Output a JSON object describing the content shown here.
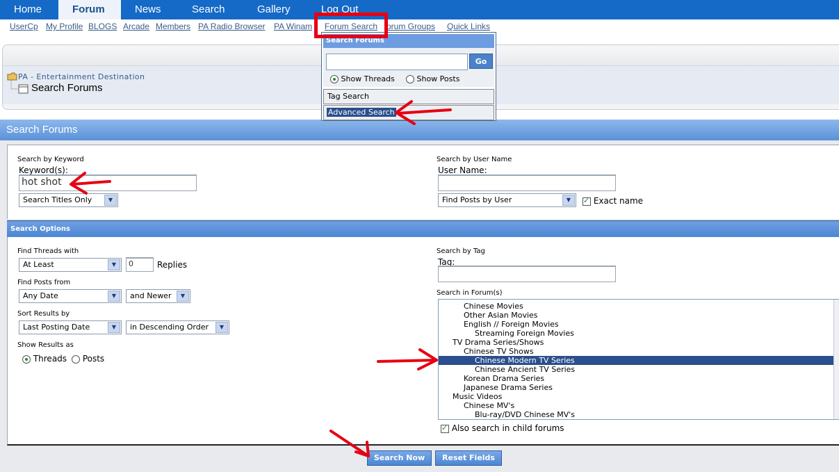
{
  "nav": {
    "tabs": [
      {
        "label": "Home",
        "active": false
      },
      {
        "label": "Forum",
        "active": true
      },
      {
        "label": "News",
        "active": false
      },
      {
        "label": "Search",
        "active": false
      },
      {
        "label": "Gallery",
        "active": false
      },
      {
        "label": "Log Out",
        "active": false
      }
    ],
    "sublinks": [
      "UserCp",
      "My Profile",
      "BLOGS",
      "Arcade",
      "Members",
      "PA Radio Browser",
      "PA Winam",
      "Forum Search",
      "orum Groups",
      "Quick Links"
    ]
  },
  "breadcrumb": {
    "site": "PA - Entertainment Destination",
    "title": "Search Forums"
  },
  "dropdown": {
    "heading": "Search Forums",
    "go_label": "Go",
    "radio_threads": "Show Threads",
    "radio_posts": "Show Posts",
    "tag_search": "Tag Search",
    "advanced_search": "Advanced Search"
  },
  "main": {
    "title": "Search Forums",
    "keyword_section": "Search by Keyword",
    "keyword_label": "Keyword(s):",
    "keyword_value": "hot shot",
    "keyword_mode": "Search Titles Only",
    "user_section": "Search by User Name",
    "user_label": "User Name:",
    "user_mode": "Find Posts by User",
    "exact_name": "Exact name",
    "options_title": "Search Options",
    "find_threads": "Find Threads with",
    "at_least": "At Least",
    "replies_value": "0",
    "replies_label": "Replies",
    "find_posts": "Find Posts from",
    "any_date": "Any Date",
    "and_newer": "and Newer",
    "sort_by": "Sort Results by",
    "sort_field": "Last Posting Date",
    "sort_order": "in Descending Order",
    "show_as": "Show Results as",
    "show_threads": "Threads",
    "show_posts": "Posts",
    "tag_section": "Search by Tag",
    "tag_label": "Tag:",
    "forums_section": "Search in Forum(s)",
    "forums": [
      {
        "name": "Chinese Movies",
        "level": 2,
        "selected": false
      },
      {
        "name": "Other Asian Movies",
        "level": 2,
        "selected": false
      },
      {
        "name": "English // Foreign Movies",
        "level": 2,
        "selected": false
      },
      {
        "name": "Streaming Foreign Movies",
        "level": 3,
        "selected": false
      },
      {
        "name": "TV Drama Series/Shows",
        "level": 1,
        "selected": false
      },
      {
        "name": "Chinese TV Shows",
        "level": 2,
        "selected": false
      },
      {
        "name": "Chinese Modern TV Series",
        "level": 3,
        "selected": true
      },
      {
        "name": "Chinese Ancient TV Series",
        "level": 3,
        "selected": false
      },
      {
        "name": "Korean Drama Series",
        "level": 2,
        "selected": false
      },
      {
        "name": "Japanese Drama Series",
        "level": 2,
        "selected": false
      },
      {
        "name": "Music Videos",
        "level": 1,
        "selected": false
      },
      {
        "name": "Chinese MV's",
        "level": 2,
        "selected": false
      },
      {
        "name": "Blu-ray/DVD Chinese MV's",
        "level": 3,
        "selected": false
      }
    ],
    "child_forums": "Also search in child forums",
    "search_now": "Search Now",
    "reset_fields": "Reset Fields"
  },
  "colors": {
    "nav_blue": "#1569c7",
    "annotation_red": "#e60012",
    "selection": "#2a4f8c"
  }
}
